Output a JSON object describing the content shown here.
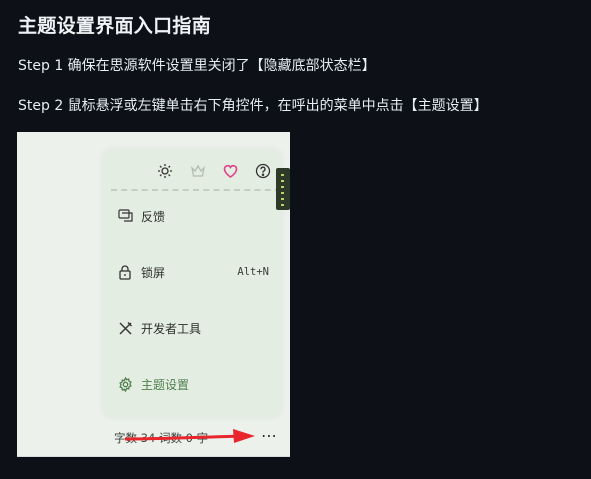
{
  "page": {
    "title": "主题设置界面入口指南",
    "step1": "Step 1 确保在思源软件设置里关闭了【隐藏底部状态栏】",
    "step2": "Step 2 鼠标悬浮或左键单击右下角控件，在呼出的菜单中点击【主题设置】"
  },
  "screenshot": {
    "menu": {
      "icons": [
        "sun-icon",
        "crown-icon",
        "heart-icon",
        "help-icon"
      ],
      "items": [
        {
          "label": "反馈",
          "icon": "feedback-icon",
          "shortcut": ""
        },
        {
          "label": "锁屏",
          "icon": "lock-icon",
          "shortcut": "Alt+N"
        },
        {
          "label": "开发者工具",
          "icon": "tools-icon",
          "shortcut": ""
        },
        {
          "label": "主题设置",
          "icon": "gear-icon",
          "shortcut": ""
        }
      ]
    },
    "statusbar": {
      "text": "字数 34 词数 0 字",
      "more": "⋯"
    }
  },
  "colors": {
    "background": "#0d1117",
    "menu_bg": "#e4ede1",
    "heart": "#e0438a",
    "theme_item": "#4f7f4f",
    "arrow": "#e8262c"
  }
}
